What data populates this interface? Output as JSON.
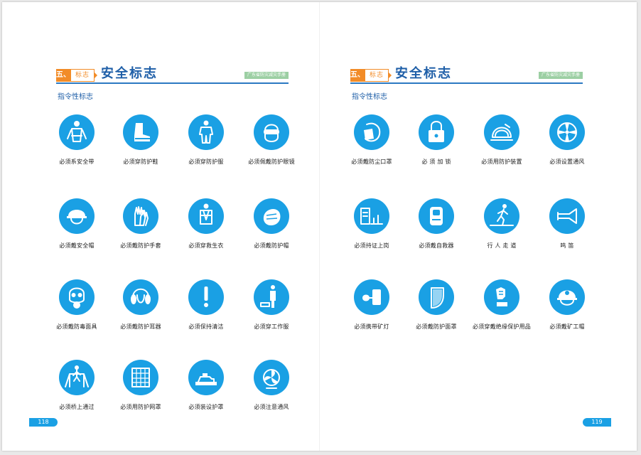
{
  "pages": [
    {
      "chapter_num": "五、",
      "chapter_tag": "标志",
      "title": "安全标志",
      "brand": "广东省防灾减灾手册",
      "subtitle": "指令性标志",
      "page_number": "118",
      "signs": [
        {
          "label": "必须系安全带",
          "icon": "safety-belt-icon"
        },
        {
          "label": "必须穿防护鞋",
          "icon": "protective-boots-icon"
        },
        {
          "label": "必须穿防护服",
          "icon": "protective-clothing-icon"
        },
        {
          "label": "必须佩戴防护眼镜",
          "icon": "goggles-icon"
        },
        {
          "label": "必须戴安全帽",
          "icon": "safety-helmet-icon"
        },
        {
          "label": "必须戴防护手套",
          "icon": "gloves-icon"
        },
        {
          "label": "必须穿救生衣",
          "icon": "life-jacket-icon"
        },
        {
          "label": "必须戴防护帽",
          "icon": "protective-cap-icon"
        },
        {
          "label": "必须戴防毒面具",
          "icon": "gas-mask-icon"
        },
        {
          "label": "必须戴防护耳器",
          "icon": "ear-protector-icon"
        },
        {
          "label": "必须保持清洁",
          "icon": "exclamation-icon"
        },
        {
          "label": "必须穿工作服",
          "icon": "work-clothes-icon"
        },
        {
          "label": "必须桥上通过",
          "icon": "bridge-crossing-icon"
        },
        {
          "label": "必须用防护网罩",
          "icon": "protective-net-icon"
        },
        {
          "label": "必须装设护罩",
          "icon": "machine-guard-icon"
        },
        {
          "label": "必须注意通风",
          "icon": "ventilation-fan-icon"
        }
      ]
    },
    {
      "chapter_num": "五、",
      "chapter_tag": "标志",
      "title": "安全标志",
      "brand": "广东省防灾减灾手册",
      "subtitle": "指令性标志",
      "page_number": "119",
      "signs": [
        {
          "label": "必须戴防尘口罩",
          "icon": "dust-mask-icon"
        },
        {
          "label": "必 须 加 锁",
          "icon": "padlock-icon"
        },
        {
          "label": "必须用防护装置",
          "icon": "saw-guard-icon"
        },
        {
          "label": "必须设置通风",
          "icon": "fan-icon"
        },
        {
          "label": "必须持证上岗",
          "icon": "certificate-icon"
        },
        {
          "label": "必须戴自救器",
          "icon": "self-rescuer-icon"
        },
        {
          "label": "行 人 走 道",
          "icon": "pedestrian-icon"
        },
        {
          "label": "鸣  笛",
          "icon": "horn-icon"
        },
        {
          "label": "必须携带矿灯",
          "icon": "miner-lamp-icon"
        },
        {
          "label": "必须戴防护面罩",
          "icon": "face-shield-icon"
        },
        {
          "label": "必须穿戴绝缘保护用品",
          "icon": "insulation-gear-icon"
        },
        {
          "label": "必须戴矿工帽",
          "icon": "miner-helmet-icon"
        }
      ]
    }
  ],
  "colors": {
    "sign_blue": "#1aa0e4",
    "title_blue": "#1f5fa8",
    "chapter_orange": "#f28c28",
    "brand_green": "#9ccfa3"
  }
}
